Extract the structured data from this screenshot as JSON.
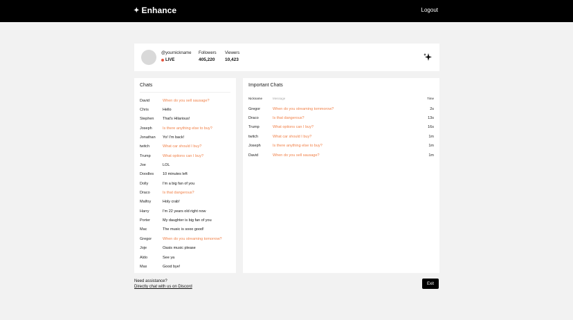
{
  "header": {
    "brand": "Enhance",
    "logout": "Logout"
  },
  "profile": {
    "handle": "@yournickname",
    "status": "LIVE",
    "followers_label": "Followers",
    "followers_value": "405,220",
    "viewers_label": "Viewers",
    "viewers_value": "10,423"
  },
  "chats": {
    "title": "Chats",
    "items": [
      {
        "name": "David",
        "message": "When do you sell sausage?",
        "highlight": true
      },
      {
        "name": "Chris",
        "message": "Hello",
        "highlight": false
      },
      {
        "name": "Stephen",
        "message": "That's Hilarious!",
        "highlight": false
      },
      {
        "name": "Joseph",
        "message": "Is there anything else to buy?",
        "highlight": true
      },
      {
        "name": "Jonathan",
        "message": "Yo! I'm back!",
        "highlight": false
      },
      {
        "name": "twitch",
        "message": "What car should I buy?",
        "highlight": true
      },
      {
        "name": "Trump",
        "message": "What options can I buy?",
        "highlight": true
      },
      {
        "name": "Joe",
        "message": "LOL",
        "highlight": false
      },
      {
        "name": "Doodles",
        "message": "10 minutes left",
        "highlight": false
      },
      {
        "name": "Dolly",
        "message": "I'm a big fan of you",
        "highlight": false
      },
      {
        "name": "Draco",
        "message": "Is that dangerous?",
        "highlight": true
      },
      {
        "name": "Malfoy",
        "message": "Holy crab!",
        "highlight": false
      },
      {
        "name": "Harry",
        "message": "I'm 22 years old right now",
        "highlight": false
      },
      {
        "name": "Porter",
        "message": "My daughter is big fan of you",
        "highlight": false
      },
      {
        "name": "Mac",
        "message": "The music is sooo good!",
        "highlight": false
      },
      {
        "name": "Gregor",
        "message": "When do you streaming tomorrow?",
        "highlight": true
      },
      {
        "name": "Joje",
        "message": "Oasis music please",
        "highlight": false
      },
      {
        "name": "Aldo",
        "message": "See ya",
        "highlight": false
      },
      {
        "name": "Max",
        "message": "Good bye!",
        "highlight": false
      }
    ]
  },
  "important": {
    "title": "Important Chats",
    "col_nick": "Nickname",
    "col_msg": "Message",
    "col_time": "Time",
    "items": [
      {
        "name": "Gregor",
        "message": "When do you streaming tommorow?",
        "time": "2s"
      },
      {
        "name": "Draco",
        "message": "Is that dangerous?",
        "time": "13s"
      },
      {
        "name": "Trump",
        "message": "What options can I buy?",
        "time": "16s"
      },
      {
        "name": "twitch",
        "message": "What car should I buy?",
        "time": "1m"
      },
      {
        "name": "Joseph",
        "message": "Is there anything else to buy?",
        "time": "1m"
      },
      {
        "name": "David",
        "message": "When do you sell sausage?",
        "time": "1m"
      }
    ]
  },
  "footer": {
    "help_text": "Need assistance?",
    "help_link": "Directly chat with us on Discord",
    "exit": "Exit"
  },
  "colors": {
    "accent": "#f08048",
    "live": "#e5533d"
  }
}
